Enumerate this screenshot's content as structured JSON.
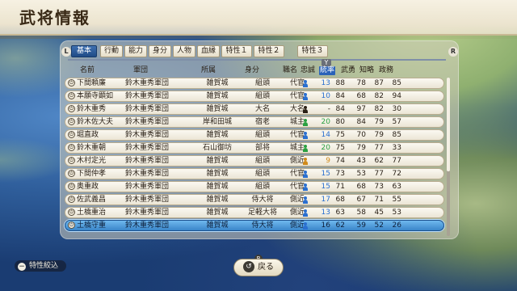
{
  "header": {
    "title": "武将情報"
  },
  "shoulders": {
    "left": "L",
    "right": "R"
  },
  "tabs": [
    "基本",
    "行動",
    "能力",
    "身分",
    "人物",
    "血縁",
    "特性１",
    "特性２",
    "特性３"
  ],
  "active_tab": "基本",
  "sort_marker": "Y",
  "columns": {
    "name": "名前",
    "clan": "軍団",
    "castle": "所属",
    "rank": "身分",
    "post": "職名",
    "loyalty": "忠誠",
    "leadership": "統率",
    "war": "武勇",
    "intellect": "知略",
    "politics": "政務"
  },
  "sorted_column": "統率",
  "rows": [
    {
      "name": "下間頼廉",
      "clan": "鈴木重秀軍団",
      "castle": "雑賀城",
      "rank": "組頭",
      "post": "代官",
      "loyalty": "13",
      "leadership": "88",
      "war": "78",
      "intellect": "87",
      "politics": "85",
      "loyalty_color": "#2a6fd0"
    },
    {
      "name": "本願寺顕如",
      "clan": "鈴木重秀軍団",
      "castle": "雑賀城",
      "rank": "組頭",
      "post": "代官",
      "loyalty": "10",
      "leadership": "84",
      "war": "68",
      "intellect": "82",
      "politics": "94",
      "loyalty_color": "#2a6fd0"
    },
    {
      "name": "鈴木重秀",
      "clan": "鈴木重秀軍団",
      "castle": "雑賀城",
      "rank": "大名",
      "post": "大名",
      "loyalty": "-",
      "leadership": "84",
      "war": "97",
      "intellect": "82",
      "politics": "30",
      "loyalty_color": "#2a2016"
    },
    {
      "name": "鈴木佐大夫",
      "clan": "鈴木重秀軍団",
      "castle": "岸和田城",
      "rank": "宿老",
      "post": "城主",
      "loyalty": "20",
      "leadership": "80",
      "war": "84",
      "intellect": "79",
      "politics": "57",
      "loyalty_color": "#2aa040"
    },
    {
      "name": "堀直政",
      "clan": "鈴木重秀軍団",
      "castle": "雑賀城",
      "rank": "組頭",
      "post": "代官",
      "loyalty": "14",
      "leadership": "75",
      "war": "70",
      "intellect": "79",
      "politics": "85",
      "loyalty_color": "#2a6fd0"
    },
    {
      "name": "鈴木重朝",
      "clan": "鈴木重秀軍団",
      "castle": "石山御坊",
      "rank": "部将",
      "post": "城主",
      "loyalty": "20",
      "leadership": "75",
      "war": "79",
      "intellect": "77",
      "politics": "33",
      "loyalty_color": "#2aa040"
    },
    {
      "name": "木村定光",
      "clan": "鈴木重秀軍団",
      "castle": "雑賀城",
      "rank": "組頭",
      "post": "側近",
      "loyalty": "9",
      "leadership": "74",
      "war": "43",
      "intellect": "62",
      "politics": "77",
      "loyalty_color": "#d08a1a"
    },
    {
      "name": "下間仲孝",
      "clan": "鈴木重秀軍団",
      "castle": "雑賀城",
      "rank": "組頭",
      "post": "代官",
      "loyalty": "15",
      "leadership": "73",
      "war": "53",
      "intellect": "77",
      "politics": "72",
      "loyalty_color": "#2a6fd0"
    },
    {
      "name": "奥重政",
      "clan": "鈴木重秀軍団",
      "castle": "雑賀城",
      "rank": "組頭",
      "post": "代官",
      "loyalty": "15",
      "leadership": "71",
      "war": "68",
      "intellect": "73",
      "politics": "63",
      "loyalty_color": "#2a6fd0"
    },
    {
      "name": "佐武義昌",
      "clan": "鈴木重秀軍団",
      "castle": "雑賀城",
      "rank": "侍大将",
      "post": "側近",
      "loyalty": "17",
      "leadership": "68",
      "war": "67",
      "intellect": "71",
      "politics": "55",
      "loyalty_color": "#2a6fd0"
    },
    {
      "name": "土橋重治",
      "clan": "鈴木重秀軍団",
      "castle": "雑賀城",
      "rank": "足軽大将",
      "post": "側近",
      "loyalty": "13",
      "leadership": "63",
      "war": "58",
      "intellect": "45",
      "politics": "53",
      "loyalty_color": "#2a6fd0"
    },
    {
      "name": "土橋守重",
      "clan": "鈴木重秀軍団",
      "castle": "雑賀城",
      "rank": "侍大将",
      "post": "側近",
      "loyalty": "16",
      "leadership": "62",
      "war": "59",
      "intellect": "52",
      "politics": "26",
      "loyalty_color": "#2a6fd0"
    }
  ],
  "selected_row": 11,
  "footer": {
    "filter_label": "特性絞込",
    "filter_key": "−",
    "back_label": "戻る",
    "back_key": "B"
  }
}
